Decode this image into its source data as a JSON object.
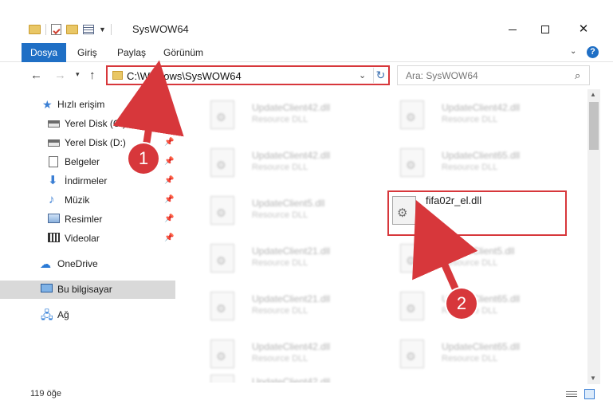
{
  "window": {
    "title": "SysWOW64"
  },
  "ribbon": {
    "tabs": [
      "Dosya",
      "Giriş",
      "Paylaş",
      "Görünüm"
    ],
    "help": "?"
  },
  "nav": {
    "address": "C:\\Windows\\SysWOW64",
    "search_placeholder": "Ara: SysWOW64"
  },
  "sidebar": {
    "items": [
      {
        "label": "Hızlı erişim"
      },
      {
        "label": "Yerel Disk (C:)"
      },
      {
        "label": "Yerel Disk (D:)"
      },
      {
        "label": "Belgeler"
      },
      {
        "label": "İndirmeler"
      },
      {
        "label": "Müzik"
      },
      {
        "label": "Resimler"
      },
      {
        "label": "Videolar"
      },
      {
        "label": "OneDrive"
      },
      {
        "label": "Bu bilgisayar"
      },
      {
        "label": "Ağ"
      }
    ]
  },
  "files": [
    {
      "name": "UpdateClient42.dll",
      "type": "Resource DLL"
    },
    {
      "name": "UpdateClient42.dll",
      "type": "Resource DLL"
    },
    {
      "name": "UpdateClient42.dll",
      "type": "Resource DLL"
    },
    {
      "name": "UpdateClient65.dll",
      "type": "Resource DLL"
    },
    {
      "name": "UpdateClient5.dll",
      "type": "Resource DLL"
    },
    {
      "name": "UpdateClient21.dll",
      "type": "Resource DLL"
    },
    {
      "name": "UpdateClient5.dll",
      "type": "Resource DLL"
    },
    {
      "name": "UpdateClient21.dll",
      "type": "Resource DLL"
    },
    {
      "name": "UpdateClient65.dll",
      "type": "Resource DLL"
    },
    {
      "name": "UpdateClient42.dll",
      "type": "Resource DLL"
    },
    {
      "name": "UpdateClient42.dll",
      "type": "Resource DLL"
    },
    {
      "name": "UpdateClient65.dll",
      "type": "Resource DLL"
    }
  ],
  "highlighted_file": {
    "name": "fifa02r_el.dll"
  },
  "status": {
    "count": "119 öğe"
  },
  "annotations": {
    "step1": "1",
    "step2": "2",
    "color": "#d7373b"
  }
}
